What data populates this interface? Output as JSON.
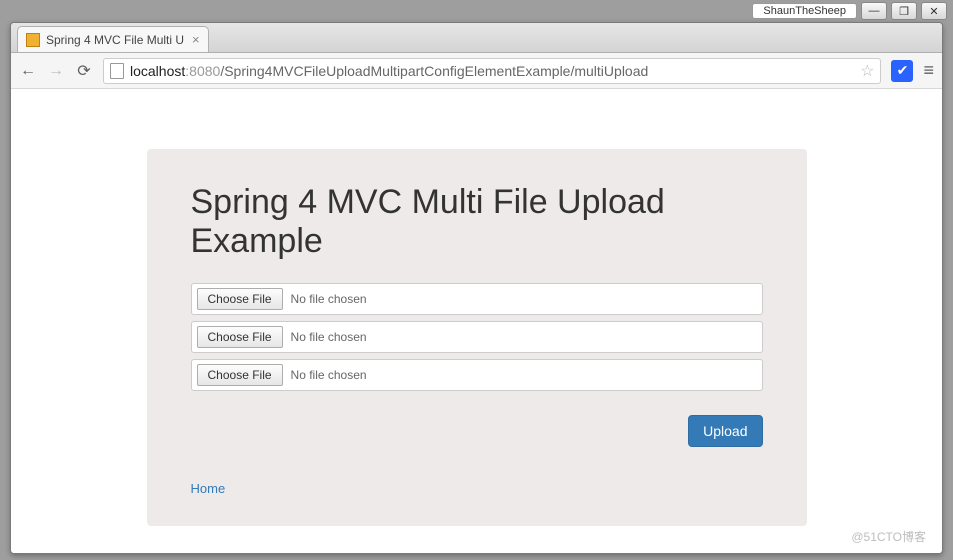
{
  "os": {
    "app_name": "ShaunTheSheep",
    "min": "—",
    "max": "❐",
    "close": "✕"
  },
  "browser": {
    "tab_title": "Spring 4 MVC File Multi U",
    "tab_close": "×",
    "url_host": "localhost",
    "url_port": ":8080",
    "url_path": "/Spring4MVCFileUploadMultipartConfigElementExample/multiUpload",
    "star": "☆",
    "ext_check": "✔",
    "hamburger": "≡"
  },
  "page": {
    "heading": "Spring 4 MVC Multi File Upload Example",
    "file_inputs": [
      {
        "button": "Choose File",
        "status": "No file chosen"
      },
      {
        "button": "Choose File",
        "status": "No file chosen"
      },
      {
        "button": "Choose File",
        "status": "No file chosen"
      }
    ],
    "upload_label": "Upload",
    "home_label": "Home"
  },
  "watermark": "@51CTO博客"
}
